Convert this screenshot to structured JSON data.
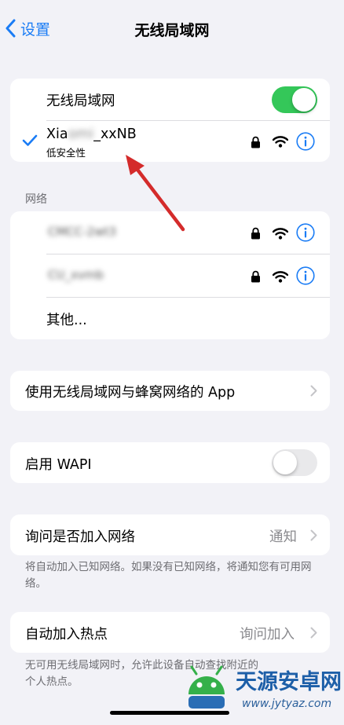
{
  "nav": {
    "back_label": "设置",
    "title": "无线局域网"
  },
  "wifi_group": {
    "toggle_label": "无线局域网",
    "toggle_on": true,
    "connected": {
      "name_prefix": "Xia",
      "name_hidden": "omi",
      "name_suffix": "_xxNB",
      "subtitle": "低安全性"
    }
  },
  "networks": {
    "header": "网络",
    "items": [
      {
        "name": "CMCC-2wt3"
      },
      {
        "name": "CU_xvmb"
      }
    ],
    "other_label": "其他..."
  },
  "apps_row": {
    "label": "使用无线局域网与蜂窝网络的 App"
  },
  "wapi_row": {
    "label": "启用 WAPI",
    "toggle_on": false
  },
  "ask_join": {
    "label": "询问是否加入网络",
    "value": "通知",
    "footer": "将自动加入已知网络。如果没有已知网络，将通知您有可用网络。"
  },
  "hotspot": {
    "label": "自动加入热点",
    "value": "询问加入",
    "footer": "无可用无线局域网时，允许此设备自动查找附近的个人热点。"
  },
  "watermark": {
    "text": "天源安卓网",
    "url": "www.jytyaz.com"
  },
  "colors": {
    "accent": "#1a7cf5",
    "toggle_on": "#34c759",
    "annotation_arrow": "#d42b2b"
  }
}
